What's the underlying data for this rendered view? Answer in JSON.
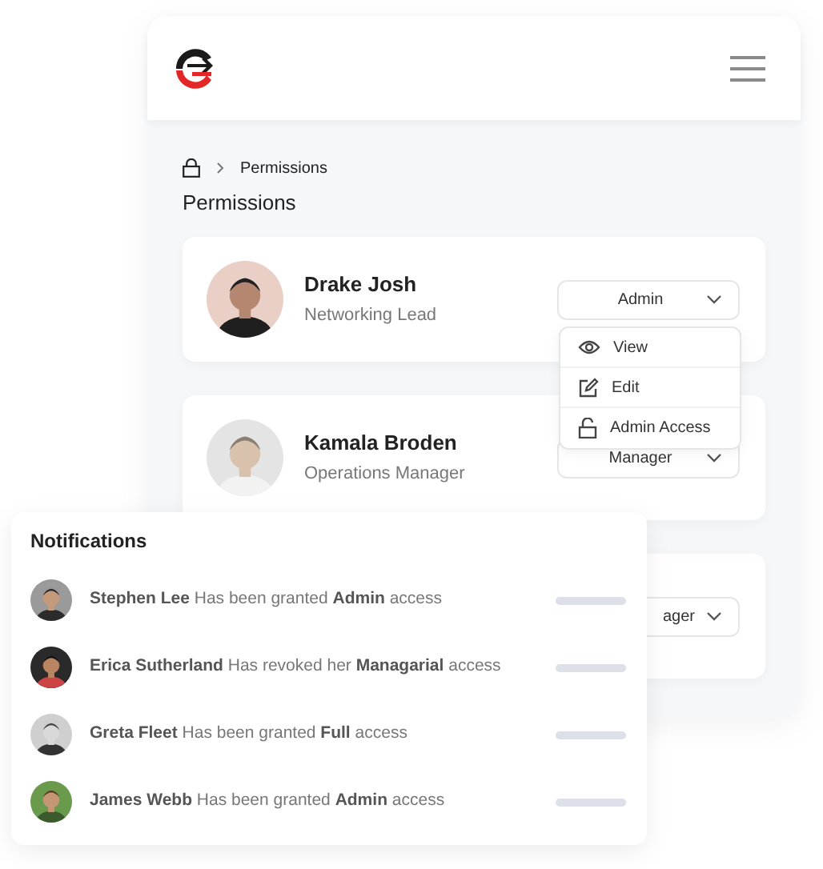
{
  "breadcrumb": {
    "current": "Permissions"
  },
  "title": "Permissions",
  "users": [
    {
      "name": "Drake Josh",
      "role": "Networking Lead",
      "access": "Admin",
      "menu_items": [
        {
          "label": "View",
          "kind": "view"
        },
        {
          "label": "Edit",
          "kind": "edit"
        },
        {
          "label": "Admin Access",
          "kind": "access"
        }
      ]
    },
    {
      "name": "Kamala Broden",
      "role": "Operations Manager",
      "access": "Manager"
    },
    {
      "access": "ager"
    }
  ],
  "notifications": {
    "title": "Notifications",
    "items": [
      {
        "text": "**Stephen Lee** Has been granted **Admin** access"
      },
      {
        "text": "**Erica Sutherland** Has revoked her **Managarial** access"
      },
      {
        "text": "**Greta Fleet** Has been granted **Full** access"
      },
      {
        "text": "**James Webb** Has been granted **Admin** access"
      }
    ]
  }
}
